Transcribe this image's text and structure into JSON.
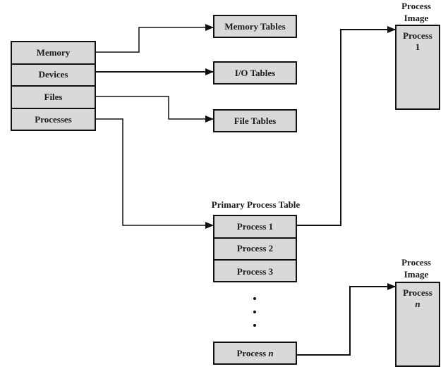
{
  "os_tables": {
    "items": [
      {
        "label": "Memory"
      },
      {
        "label": "Devices"
      },
      {
        "label": "Files"
      },
      {
        "label": "Processes"
      }
    ]
  },
  "resource_tables": {
    "memory": "Memory Tables",
    "io": "I/O Tables",
    "file": "File Tables"
  },
  "primary_process_table": {
    "title": "Primary Process Table",
    "rows": [
      {
        "label": "Process 1"
      },
      {
        "label": "Process 2"
      },
      {
        "label": "Process 3"
      }
    ],
    "last_prefix": "Process ",
    "last_suffix": "n"
  },
  "process_images": [
    {
      "title_line1": "Process",
      "title_line2": "Image",
      "name_line1": "Process",
      "name_line2": "1",
      "italic": false
    },
    {
      "title_line1": "Process",
      "title_line2": "Image",
      "name_line1": "Process",
      "name_line2": "n",
      "italic": true
    }
  ],
  "colors": {
    "box_fill": "#d9d9d9",
    "stroke": "#111111"
  }
}
